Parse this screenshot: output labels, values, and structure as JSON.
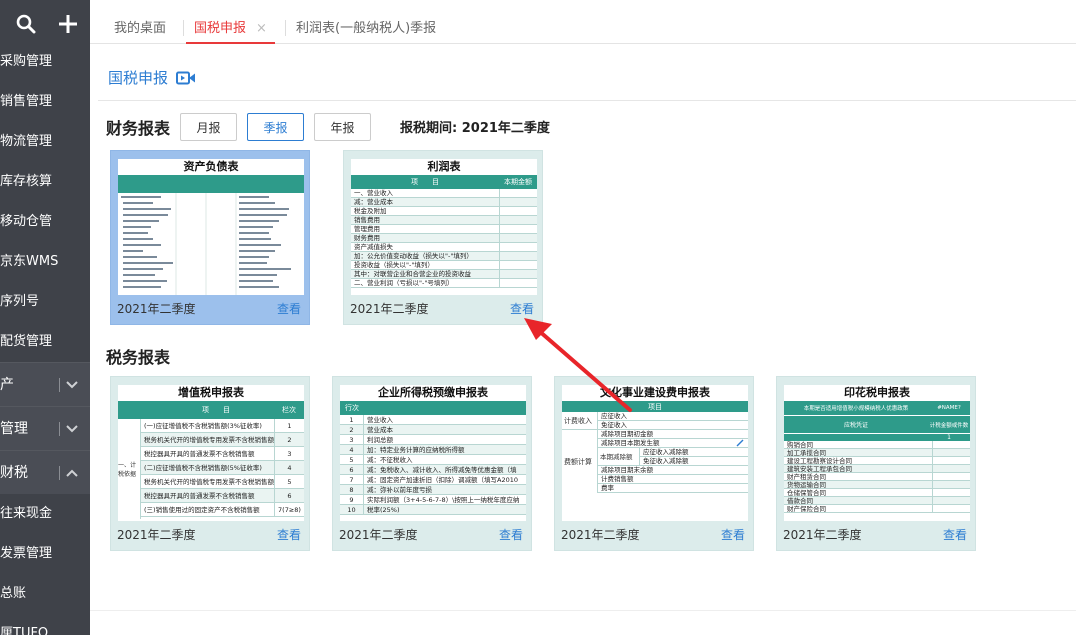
{
  "sidebar": {
    "items": [
      {
        "label": "采购管理"
      },
      {
        "label": "销售管理"
      },
      {
        "label": "物流管理"
      },
      {
        "label": "库存核算"
      },
      {
        "label": "移动仓管"
      },
      {
        "label": "京东WMS"
      },
      {
        "label": "序列号"
      },
      {
        "label": "配货管理"
      }
    ],
    "groups": [
      {
        "label": "产"
      },
      {
        "label": "管理"
      },
      {
        "label": "财税"
      }
    ],
    "sub_items": [
      {
        "label": "往来现金"
      },
      {
        "label": "发票管理"
      },
      {
        "label": "总账"
      },
      {
        "label": "厘TUFO"
      }
    ]
  },
  "tabs": [
    {
      "label": "我的桌面"
    },
    {
      "label": "国税申报",
      "close": "×"
    },
    {
      "label": "利润表(一般纳税人)季报"
    }
  ],
  "page": {
    "title": "国税申报",
    "financial_label": "财务报表",
    "tax_label": "税务报表",
    "period_buttons": [
      {
        "label": "月报"
      },
      {
        "label": "季报"
      },
      {
        "label": "年报"
      }
    ],
    "period_text": "报税期间: 2021年二季度"
  },
  "financial_cards": [
    {
      "thumb_title": "资产负债表",
      "period": "2021年二季度",
      "view": "查看"
    },
    {
      "thumb_title": "利润表",
      "period": "2021年二季度",
      "view": "查看",
      "thumb_head": [
        "项　　目",
        "本期金额"
      ],
      "rows": [
        "一、营业收入",
        "减：营业成本",
        "税金及附加",
        "销售费用",
        "管理费用",
        "财务费用",
        "资产减值损失",
        "加：公允价值变动收益（损失以\"-\"填列）",
        "投资收益（损失以\"-\"填列）",
        "其中：对联营企业和合营企业的投资收益",
        "二、营业利润（亏损以\"-\"号填列）"
      ]
    }
  ],
  "tax_cards": [
    {
      "thumb_title": "增值税申报表",
      "period": "2021年二季度",
      "view": "查看",
      "thumb_head": [
        "项　　目",
        "栏次"
      ],
      "side_label": "一、计税依据",
      "rows": [
        "(一)应征增值税不含税销售额(3%征收率)",
        "税务机关代开的增值税专用发票不含税销售额",
        "税控器具开具的普通发票不含税销售额",
        "(二)应征增值税不含税销售额(5%征收率)",
        "税务机关代开的增值税专用发票不含税销售额",
        "税控器具开具的普通发票不含税销售额",
        "(三)销售使用过的固定资产不含税销售额"
      ],
      "nums": [
        "1",
        "2",
        "3",
        "4",
        "5",
        "6",
        "7(7≥8)"
      ]
    },
    {
      "thumb_title": "企业所得税预缴申报表",
      "period": "2021年二季度",
      "view": "查看",
      "thumb_head": [
        "行次",
        ""
      ],
      "rows": [
        "营业收入",
        "营业成本",
        "利润总额",
        "加：特定业务计算的应纳税所得额",
        "减：不征税收入",
        "减：免税收入、减计收入、所得减免等优惠金额（填",
        "减：固定资产加速折旧（扣除）调减额（填写A2010",
        "减：弥补以前年度亏损",
        "实际利润额（3+4-5-6-7-8）\\按照上一纳税年度应纳",
        "税率(25%)"
      ],
      "nums": [
        "1",
        "2",
        "3",
        "4",
        "5",
        "6",
        "7",
        "8",
        "9",
        "10"
      ]
    },
    {
      "thumb_title": "文化事业建设费申报表",
      "period": "2021年二季度",
      "view": "查看",
      "thumb_head": [
        "项目",
        ""
      ],
      "left_labels": [
        "计费收入",
        "费额计算"
      ],
      "rows": [
        "应征收入",
        "免征收入",
        "减除项目期初金额",
        "减除项目本期发生额",
        "应征收入减除额",
        "免征收入减除额",
        "减除项目期末余额",
        "计费销售额",
        "费率"
      ],
      "sub_label": "本期减除额"
    },
    {
      "thumb_title": "印花税申报表",
      "period": "2021年二季度",
      "view": "查看",
      "banner": "本期是否适用增值税小规模纳税人优惠政策",
      "banner_val": "#NAME?",
      "thumb_head": [
        "应税凭证",
        "计税金额或件数"
      ],
      "col_num": "1",
      "rows": [
        "购销合同",
        "加工承揽合同",
        "建设工程勘察设计合同",
        "建筑安装工程承包合同",
        "财产租赁合同",
        "货物运输合同",
        "仓储保管合同",
        "借款合同",
        "财产保险合同"
      ]
    }
  ],
  "colors": {
    "accent": "#2d7dd2",
    "active_tab": "#e8393a",
    "sidebar_bg": "#3f4249",
    "table_head": "#2e9b8a",
    "arrow": "#e8252a"
  }
}
